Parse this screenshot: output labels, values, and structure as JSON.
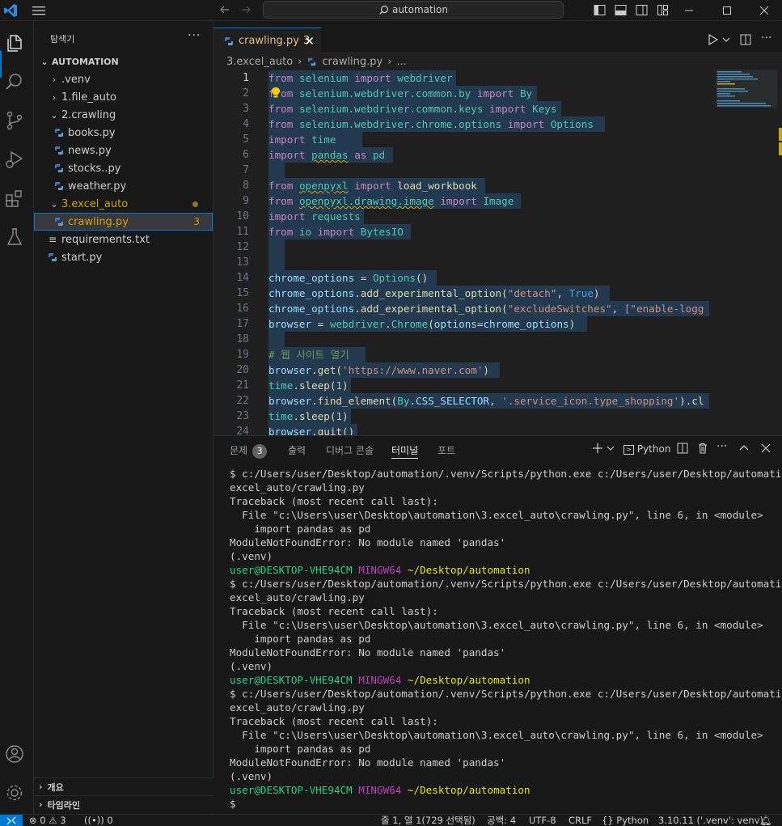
{
  "titlebar": {
    "search_text": "automation"
  },
  "sidebar": {
    "title": "탐색기",
    "more": "···",
    "root": "AUTOMATION",
    "items": [
      {
        "label": ".venv",
        "kind": "folder-collapsed"
      },
      {
        "label": "1.file_auto",
        "kind": "folder-collapsed"
      },
      {
        "label": "2.crawling",
        "kind": "folder-expanded"
      },
      {
        "label": "books.py",
        "kind": "python-file"
      },
      {
        "label": "news.py",
        "kind": "python-file"
      },
      {
        "label": "stocks..py",
        "kind": "python-file"
      },
      {
        "label": "weather.py",
        "kind": "python-file"
      },
      {
        "label": "3.excel_auto",
        "kind": "folder-expanded"
      },
      {
        "label": "crawling.py",
        "kind": "python-file",
        "badge": "3"
      },
      {
        "label": "requirements.txt",
        "kind": "text-file"
      },
      {
        "label": "start.py",
        "kind": "python-file"
      }
    ],
    "outline_label": "개요",
    "timeline_label": "타임라인"
  },
  "editor": {
    "tab_label": "crawling.py",
    "tab_badge": "3",
    "breadcrumb_folder": "3.excel_auto",
    "breadcrumb_file": "crawling.py",
    "breadcrumb_more": "...",
    "line_numbers": [
      "1",
      "2",
      "3",
      "4",
      "5",
      "6",
      "7",
      "8",
      "9",
      "10",
      "11",
      "12",
      "13",
      "14",
      "15",
      "16",
      "17",
      "18",
      "19",
      "20",
      "21",
      "22",
      "23",
      "24"
    ]
  },
  "panel": {
    "tabs": [
      {
        "label": "문제",
        "badge": "3"
      },
      {
        "label": "출력"
      },
      {
        "label": "디버그 콘솔"
      },
      {
        "label": "터미널"
      },
      {
        "label": "포트"
      }
    ],
    "shell_label": "Python",
    "terminal_lines": [
      "$ c:/Users/user/Desktop/automation/.venv/Scripts/python.exe c:/Users/user/Desktop/automation/3.",
      "excel_auto/crawling.py",
      "Traceback (most recent call last):",
      "  File \"c:\\Users\\user\\Desktop\\automation\\3.excel_auto\\crawling.py\", line 6, in <module>",
      "    import pandas as pd",
      "ModuleNotFoundError: No module named 'pandas'",
      "(.venv)"
    ],
    "prompt_user": "user@DESKTOP-VHE94CM",
    "prompt_env": "MINGW64",
    "prompt_path": "~/Desktop/automation",
    "final_prompt": "$"
  },
  "statusbar": {
    "errors": "0",
    "warnings": "3",
    "ports": "0",
    "position": "줄 1, 열 1(729 선택됨)",
    "spaces": "공백: 4",
    "encoding": "UTF-8",
    "eol": "CRLF",
    "language": "Python",
    "interpreter": "3.10.11 ('.venv': venv)"
  }
}
